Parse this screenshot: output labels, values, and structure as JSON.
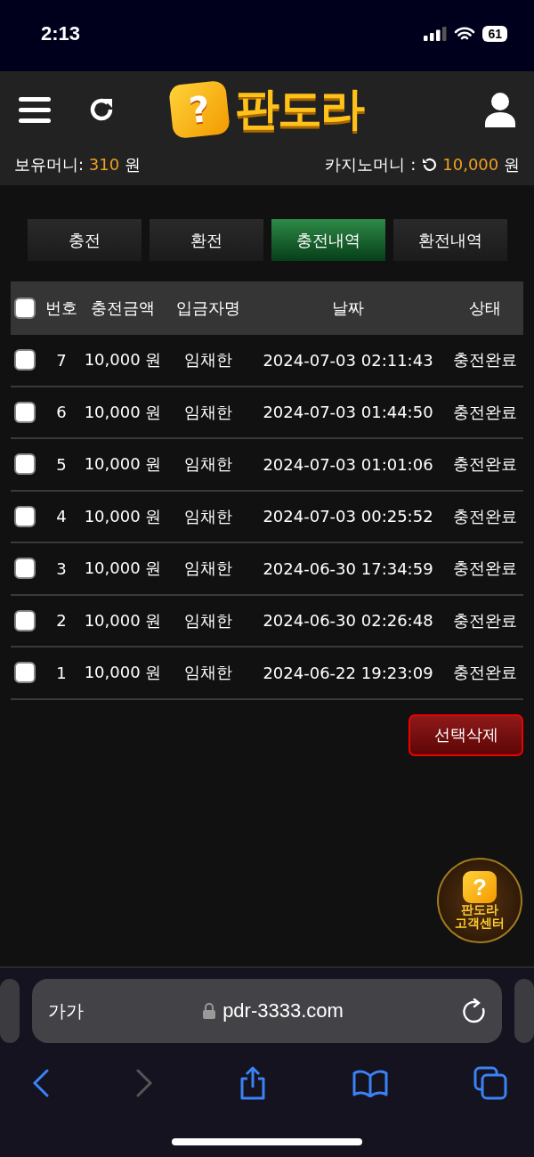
{
  "status_bar": {
    "time": "2:13",
    "battery": "61"
  },
  "header": {
    "logo_mark": "?",
    "logo_text": "판도라"
  },
  "balances": {
    "holding_label": "보유머니:",
    "holding_value": "310",
    "holding_unit": "원",
    "casino_label": "카지노머니 :",
    "casino_value": "10,000",
    "casino_unit": "원"
  },
  "tabs": [
    {
      "label": "충전",
      "selected": false
    },
    {
      "label": "환전",
      "selected": false
    },
    {
      "label": "충전내역",
      "selected": true
    },
    {
      "label": "환전내역",
      "selected": false
    }
  ],
  "table": {
    "select_all_checked": false,
    "columns": [
      "번호",
      "충전금액",
      "입금자명",
      "날짜",
      "상태"
    ],
    "rows": [
      {
        "checked": false,
        "cells": [
          "7",
          "10,000 원",
          "임채한",
          "2024-07-03 02:11:43",
          "충전완료"
        ]
      },
      {
        "checked": false,
        "cells": [
          "6",
          "10,000 원",
          "임채한",
          "2024-07-03 01:44:50",
          "충전완료"
        ]
      },
      {
        "checked": false,
        "cells": [
          "5",
          "10,000 원",
          "임채한",
          "2024-07-03 01:01:06",
          "충전완료"
        ]
      },
      {
        "checked": false,
        "cells": [
          "4",
          "10,000 원",
          "임채한",
          "2024-07-03 00:25:52",
          "충전완료"
        ]
      },
      {
        "checked": false,
        "cells": [
          "3",
          "10,000 원",
          "임채한",
          "2024-06-30 17:34:59",
          "충전완료"
        ]
      },
      {
        "checked": false,
        "cells": [
          "2",
          "10,000 원",
          "임채한",
          "2024-06-30 02:26:48",
          "충전완료"
        ]
      },
      {
        "checked": false,
        "cells": [
          "1",
          "10,000 원",
          "임채한",
          "2024-06-22 19:23:09",
          "충전완료"
        ]
      }
    ]
  },
  "delete_button": "선택삭제",
  "support_badge": {
    "mark": "?",
    "line_1": "판도라",
    "line_2": "고객센터"
  },
  "browser": {
    "text_size": "가가",
    "url": "pdr-3333.com"
  }
}
